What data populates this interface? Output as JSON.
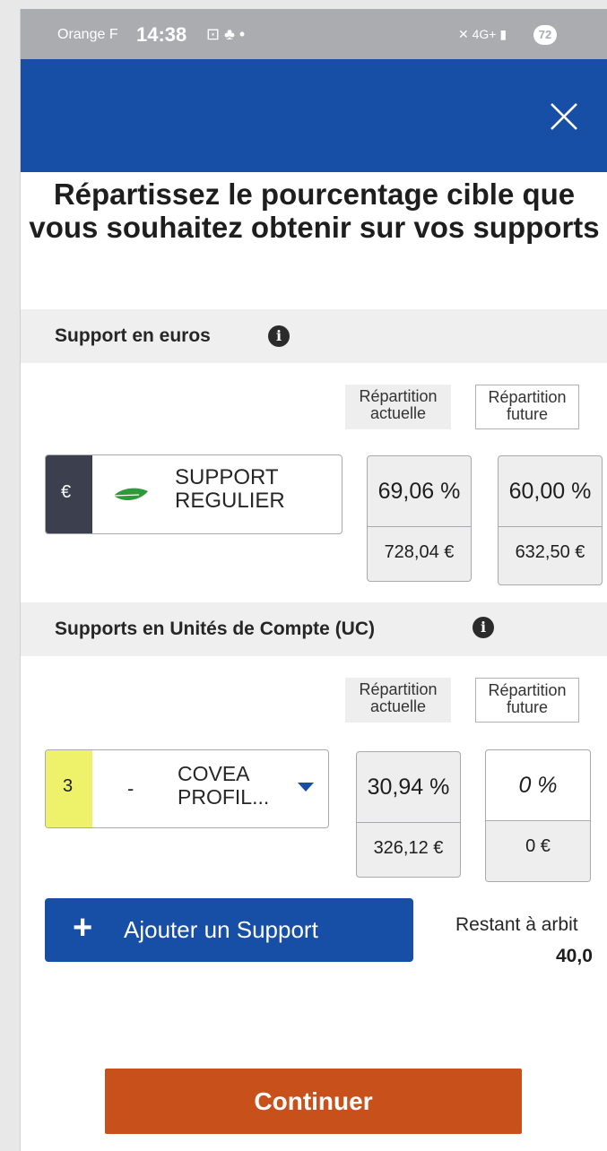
{
  "status_bar": {
    "carrier": "Orange F",
    "time": "14:38",
    "network": "4G+",
    "battery": "72"
  },
  "header": {
    "title": "Répartissez le pourcentage cible que vous souhaitez obtenir sur vos supports"
  },
  "euro_section": {
    "label": "Support en euros",
    "col_actual": "Répartition actuelle",
    "col_future": "Répartition future",
    "support": {
      "tag": "€",
      "name_line1": "SUPPORT",
      "name_line2": "REGULIER",
      "actual_pct": "69,06 %",
      "actual_eur": "728,04 €",
      "future_pct": "60,00 %",
      "future_eur": "632,50 €"
    }
  },
  "uc_section": {
    "label": "Supports en Unités de Compte (UC)",
    "col_actual": "Répartition actuelle",
    "col_future": "Répartition future",
    "support": {
      "tag": "3",
      "dash": "-",
      "name_line1": "COVEA",
      "name_line2": "PROFIL...",
      "actual_pct": "30,94 %",
      "actual_eur": "326,12 €",
      "future_pct": "0 %",
      "future_eur": "0 €"
    }
  },
  "actions": {
    "add_support": "Ajouter un Support",
    "remaining_label": "Restant à arbit",
    "remaining_value": "40,0",
    "continue": "Continuer"
  },
  "colors": {
    "brand_blue": "#174ea6",
    "continue_orange": "#c8501b",
    "euro_tag": "#3c3f4d",
    "uc_tag": "#eef26a",
    "leaf_green": "#2e9a3a"
  }
}
